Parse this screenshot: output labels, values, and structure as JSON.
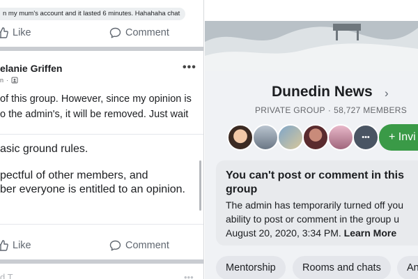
{
  "caption": "n my mum's account and it lasted 6 minutes. Hahahaha chat",
  "feed": {
    "like_label": "Like",
    "comment_label": "Comment",
    "post": {
      "author": "elanie Griffen",
      "meta_time": "n",
      "more": "•••",
      "text_line1": "of this group. However, since my opinion is",
      "text_line2": "o the admin's, it will be removed. Just wait",
      "rules_line1": "asic ground rules.",
      "rules_line2": "pectful of other members, and",
      "rules_line3": "ber everyone is entitled to an opinion."
    },
    "next_post_partial": "d T",
    "next_more": "•••"
  },
  "group": {
    "name": "Dunedin News",
    "privacy": "PRIVATE GROUP",
    "members": "58,727 MEMBERS",
    "invite_label": "+ Invi",
    "notice": {
      "title_line1": "You can't post or comment in this",
      "title_line2": "group",
      "body_line1": "The admin has temporarily turned off you",
      "body_line2": "ability to post or comment in the group u",
      "body_line3": "August 20, 2020, 3:34 PM.",
      "learn_more": "Learn More"
    },
    "chips": [
      "Mentorship",
      "Rooms and chats",
      "An"
    ]
  },
  "colors": {
    "invite_green": "#3a9a47",
    "separator": "#c9ccd1",
    "muted_text": "#65676b"
  }
}
